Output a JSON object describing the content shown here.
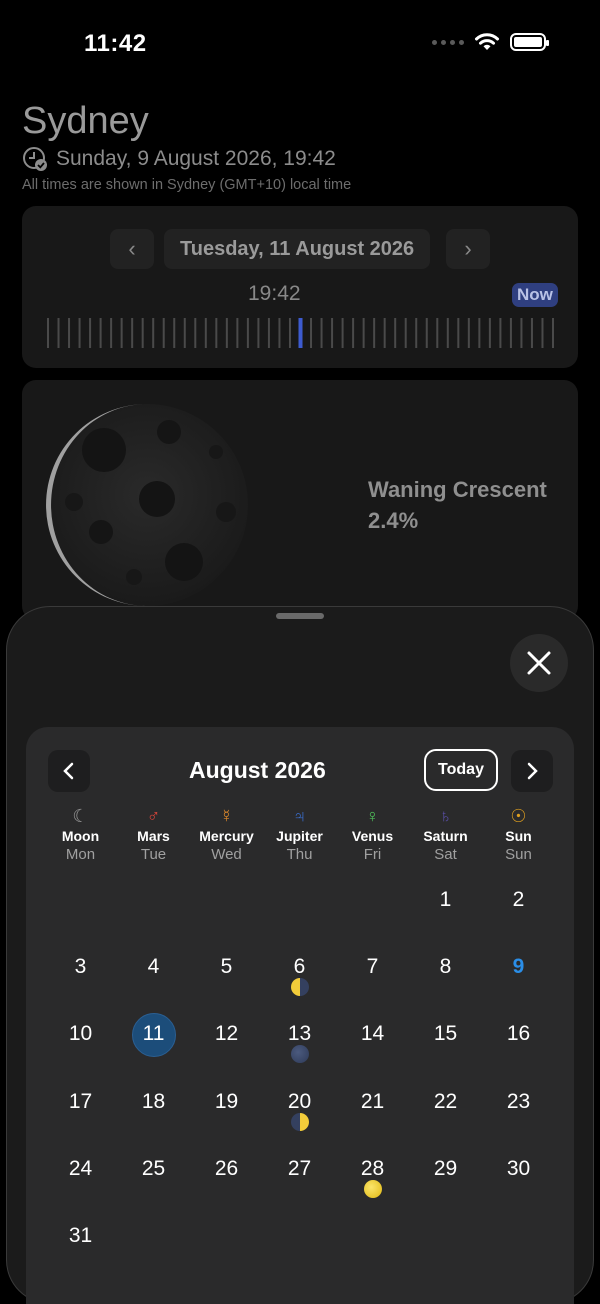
{
  "status_bar": {
    "time": "11:42"
  },
  "header": {
    "city": "Sydney",
    "datetime": "Sunday, 9 August 2026, 19:42",
    "timezone_note": "All times are shown in Sydney (GMT+10) local time"
  },
  "time_picker": {
    "date": "Tuesday, 11 August 2026",
    "time": "19:42",
    "now_label": "Now",
    "prev": "‹",
    "next": "›",
    "slider_fraction": 0.5
  },
  "moon_phase": {
    "name": "Waning Crescent",
    "illumination": "2.4%"
  },
  "calendar": {
    "month": "August 2026",
    "today_label": "Today",
    "weekdays": [
      {
        "symbol": "☾",
        "planet": "Moon",
        "day": "Mon",
        "color": "#9a9a9a"
      },
      {
        "symbol": "♂",
        "planet": "Mars",
        "day": "Tue",
        "color": "#d9443a"
      },
      {
        "symbol": "☿",
        "planet": "Mercury",
        "day": "Wed",
        "color": "#e08a2a"
      },
      {
        "symbol": "♃",
        "planet": "Jupiter",
        "day": "Thu",
        "color": "#3a6fd0"
      },
      {
        "symbol": "♀",
        "planet": "Venus",
        "day": "Fri",
        "color": "#4fbf5a"
      },
      {
        "symbol": "♄",
        "planet": "Saturn",
        "day": "Sat",
        "color": "#5b4fa8"
      },
      {
        "symbol": "☉",
        "planet": "Sun",
        "day": "Sun",
        "color": "#e0a020"
      }
    ],
    "weeks": [
      [
        "",
        "",
        "",
        "",
        "",
        "1",
        "2"
      ],
      [
        "3",
        "4",
        "5",
        "6",
        "7",
        "8",
        "9"
      ],
      [
        "10",
        "11",
        "12",
        "13",
        "14",
        "15",
        "16"
      ],
      [
        "17",
        "18",
        "19",
        "20",
        "21",
        "22",
        "23"
      ],
      [
        "24",
        "25",
        "26",
        "27",
        "28",
        "29",
        "30"
      ],
      [
        "31",
        "",
        "",
        "",
        "",
        "",
        ""
      ]
    ],
    "today_day": "9",
    "selected_day": "11",
    "today_color": "#2a8ee8",
    "phase_markers": [
      {
        "day": "6",
        "phase": "last-quarter-icon"
      },
      {
        "day": "13",
        "phase": "new-moon-icon"
      },
      {
        "day": "20",
        "phase": "first-quarter-icon"
      },
      {
        "day": "28",
        "phase": "full-moon-icon"
      }
    ]
  }
}
